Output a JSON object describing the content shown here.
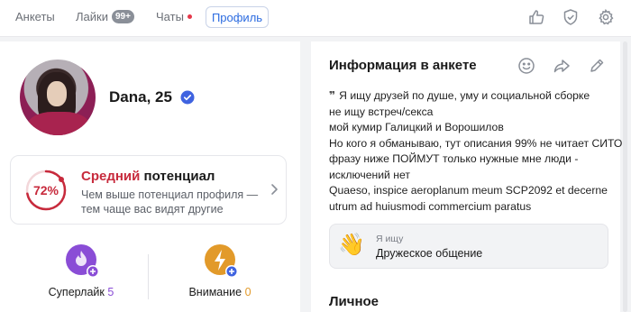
{
  "nav": {
    "tabs": [
      {
        "label": "Анкеты"
      },
      {
        "label": "Лайки",
        "badge": "99+"
      },
      {
        "label": "Чаты",
        "has_dot": true
      },
      {
        "label": "Профиль",
        "active": true
      }
    ],
    "icons": [
      "thumbs-up-icon",
      "shield-check-icon",
      "gear-icon"
    ]
  },
  "profile": {
    "name": "Dana, 25",
    "verified": true
  },
  "potential": {
    "percent_label": "72%",
    "percent": 72,
    "level": "Средний",
    "title_suffix": " потенциал",
    "description": "Чем выше потенциал профиля — тем чаще вас видят другие"
  },
  "actions": {
    "superlike": {
      "label": "Суперлайк",
      "count": "5"
    },
    "attention": {
      "label": "Внимание",
      "count": "0"
    }
  },
  "info": {
    "title": "Информация в анкете",
    "about_lines": [
      "Я ищу друзей по душе, уму и социальной сборке",
      "не ищу встреч/секса",
      "мой кумир Галицкий и Ворошилов",
      "Но кого я обманываю, тут описания 99% не читает СИТО:",
      "фразу ниже ПОЙМУТ только нужные мне люди -",
      "исключений нет",
      "Quaeso, inspice aeroplanum meum SCP2092 et decerne",
      "utrum ad huiusmodi commercium paratus"
    ],
    "looking_for_label": "Я ищу",
    "looking_for_value": "Дружеское общение",
    "looking_for_emoji": "👋",
    "personal_title": "Личное"
  },
  "colors": {
    "accent_blue": "#2b6be0",
    "potential_red": "#c72a3c",
    "superlike_purple": "#8a4dd6",
    "attention_orange": "#e29a2a"
  }
}
